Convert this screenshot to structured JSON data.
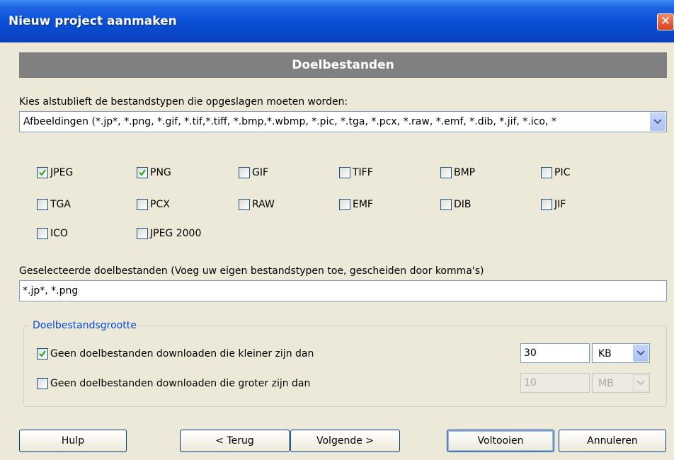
{
  "window": {
    "title": "Nieuw project aanmaken",
    "close_glyph": "✕"
  },
  "header": {
    "title": "Doelbestanden"
  },
  "filetypes": {
    "prompt": "Kies alstublieft de bestandstypen die opgeslagen moeten worden:",
    "category_value": "Afbeeldingen (*.jp*, *.png, *.gif, *.tif,*.tiff, *.bmp,*.wbmp, *.pic, *.tga, *.pcx, *.raw, *.emf, *.dib, *.jif, *.ico, *",
    "options": [
      {
        "label": "JPEG",
        "checked": true
      },
      {
        "label": "PNG",
        "checked": true
      },
      {
        "label": "GIF",
        "checked": false
      },
      {
        "label": "TIFF",
        "checked": false
      },
      {
        "label": "BMP",
        "checked": false
      },
      {
        "label": "PIC",
        "checked": false
      },
      {
        "label": "TGA",
        "checked": false
      },
      {
        "label": "PCX",
        "checked": false
      },
      {
        "label": "RAW",
        "checked": false
      },
      {
        "label": "EMF",
        "checked": false
      },
      {
        "label": "DIB",
        "checked": false
      },
      {
        "label": "JIF",
        "checked": false
      },
      {
        "label": "ICO",
        "checked": false
      },
      {
        "label": "JPEG 2000",
        "checked": false
      }
    ]
  },
  "selected": {
    "label": "Geselecteerde doelbestanden (Voeg uw eigen bestandstypen toe, gescheiden door komma's)",
    "value": "*.jp*, *.png"
  },
  "size_group": {
    "title": "Doelbestandsgrootte",
    "min": {
      "label": "Geen doelbestanden downloaden die kleiner zijn dan",
      "checked": true,
      "value": "30",
      "unit": "KB",
      "enabled": true
    },
    "max": {
      "label": "Geen doelbestanden downloaden die groter zijn dan",
      "checked": false,
      "value": "10",
      "unit": "MB",
      "enabled": false
    }
  },
  "buttons": {
    "help": "Hulp",
    "back": "< Terug",
    "next": "Volgende >",
    "finish": "Voltooien",
    "cancel": "Annuleren"
  }
}
